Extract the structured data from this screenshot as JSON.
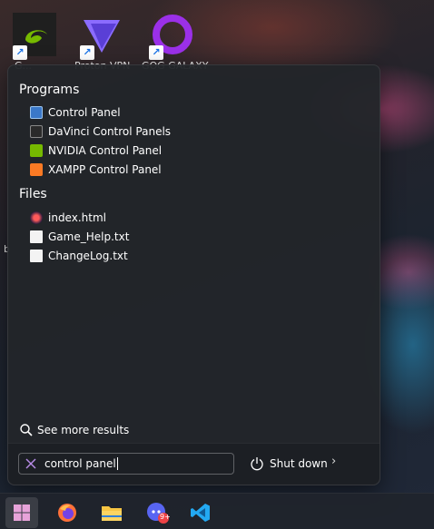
{
  "desktop": {
    "icons": [
      {
        "name": "nvidia-geforce-icon",
        "label": "G..."
      },
      {
        "name": "proton-vpn-icon",
        "label": "Proton VPN"
      },
      {
        "name": "gog-galaxy-icon",
        "label": "GOG GALAXY"
      }
    ],
    "side_label": "b"
  },
  "start_menu": {
    "programs_title": "Programs",
    "programs": [
      {
        "label": "Control Panel",
        "icon": "control-panel-icon"
      },
      {
        "label": "DaVinci Control Panels",
        "icon": "davinci-icon"
      },
      {
        "label": "NVIDIA Control Panel",
        "icon": "nvidia-icon"
      },
      {
        "label": "XAMPP Control Panel",
        "icon": "xampp-icon"
      }
    ],
    "files_title": "Files",
    "files": [
      {
        "label": "index.html",
        "icon": "html-file-icon"
      },
      {
        "label": "Game_Help.txt",
        "icon": "text-file-icon"
      },
      {
        "label": "ChangeLog.txt",
        "icon": "text-file-icon"
      }
    ],
    "see_more": "See more results",
    "search": {
      "value": "control panel"
    },
    "shutdown_label": "Shut down"
  },
  "taskbar": {
    "items": [
      {
        "name": "start-button",
        "icon": "windows-icon"
      },
      {
        "name": "firefox-button",
        "icon": "firefox-icon"
      },
      {
        "name": "file-explorer-button",
        "icon": "folder-icon"
      },
      {
        "name": "discord-button",
        "icon": "discord-icon",
        "badge": "9+"
      },
      {
        "name": "vscode-button",
        "icon": "vscode-icon"
      }
    ]
  },
  "colors": {
    "nvidia": "#76b900",
    "xampp": "#fb7a24",
    "proton": "#6d4aff",
    "gog": "#8a2be2",
    "accent": "#3a8fd8"
  }
}
